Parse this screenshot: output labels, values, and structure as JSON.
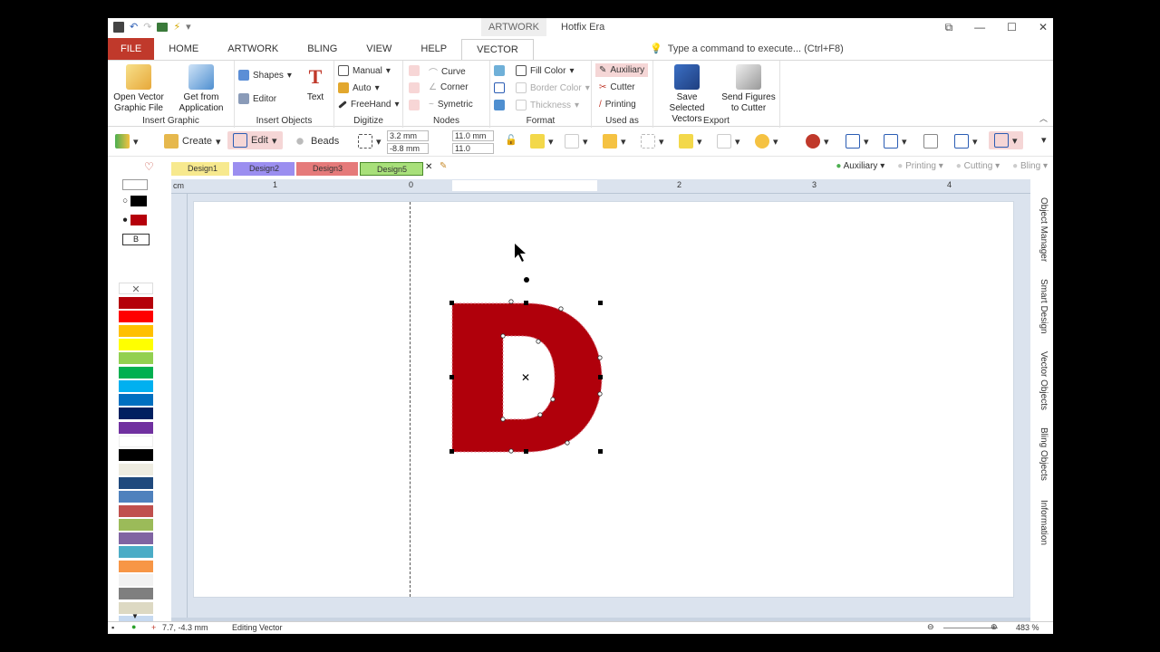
{
  "app": {
    "title": "Hotfix Era",
    "context_tab": "ARTWORK",
    "command_placeholder": "Type a command to execute... (Ctrl+F8)"
  },
  "tabs": [
    "FILE",
    "HOME",
    "ARTWORK",
    "BLING",
    "VIEW",
    "HELP",
    "VECTOR"
  ],
  "ribbon": {
    "insert_graphic": {
      "label": "Insert Graphic",
      "open_vector": "Open Vector Graphic File",
      "get_from_app": "Get from Application"
    },
    "insert_objects": {
      "label": "Insert Objects",
      "shapes": "Shapes",
      "editor": "Editor",
      "text": "Text"
    },
    "digitize": {
      "label": "Digitize",
      "manual": "Manual",
      "auto": "Auto",
      "freehand": "FreeHand"
    },
    "nodes": {
      "label": "Nodes",
      "curve": "Curve",
      "corner": "Corner",
      "symetric": "Symetric"
    },
    "format": {
      "label": "Format",
      "fill_color": "Fill Color",
      "border_color": "Border Color",
      "thickness": "Thickness"
    },
    "used_as": {
      "label": "Used as",
      "auxiliary": "Auxiliary",
      "cutter": "Cutter",
      "printing": "Printing"
    },
    "export": {
      "label": "Export",
      "save_selected": "Save Selected Vectors",
      "send_figures": "Send Figures to Cutter"
    }
  },
  "toolbar": {
    "create": "Create",
    "edit": "Edit",
    "beads": "Beads",
    "x": "3.2 mm",
    "y": "-8.8 mm",
    "w": "11.0 mm",
    "h": "11.0"
  },
  "documents": [
    "Design1",
    "Design2",
    "Design3",
    "Design5"
  ],
  "filters": {
    "auxiliary": "Auxiliary",
    "printing": "Printing",
    "cutting": "Cutting",
    "bling": "Bling"
  },
  "ruler": {
    "unit": "cm",
    "labels": [
      "1",
      "0",
      "1",
      "2",
      "3",
      "4"
    ]
  },
  "side_panels": [
    "Object Manager",
    "Smart Design",
    "Vector Objects",
    "Bling Objects",
    "Information"
  ],
  "palette": {
    "fill_label": "B",
    "colors": [
      "#b5000a",
      "#ff0000",
      "#ffc000",
      "#ffff00",
      "#92d050",
      "#00b050",
      "#00b0f0",
      "#0070c0",
      "#002060",
      "#7030a0",
      "#ffffff",
      "#000000",
      "#eeece1",
      "#1f497d",
      "#4f81bd",
      "#c0504d",
      "#9bbb59",
      "#8064a2",
      "#4bacc6",
      "#f79646",
      "#f2f2f2",
      "#7f7f7f",
      "#ddd9c3",
      "#c6d9f0"
    ]
  },
  "shape": {
    "letter": "D",
    "fill": "#b0000b"
  },
  "status": {
    "coords": "7.7, -4.3 mm",
    "mode": "Editing Vector",
    "zoom": "483 %"
  }
}
